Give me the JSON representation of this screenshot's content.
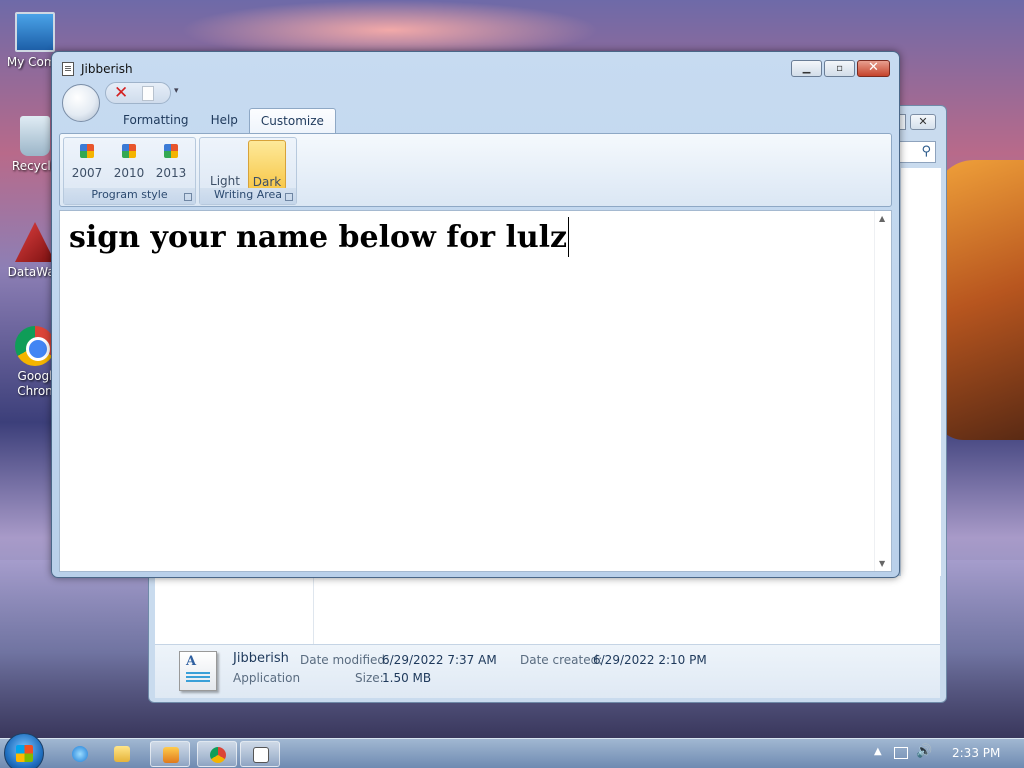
{
  "desktop": {
    "icons": [
      {
        "label": "My Comp"
      },
      {
        "label": "Recycle"
      },
      {
        "label": "DataWag"
      },
      {
        "label": "Googl Chron"
      }
    ]
  },
  "background_window": {
    "close_glyph": "✕",
    "help_glyph": "?",
    "search_glyph": "⚲",
    "details": {
      "name": "Jibberish",
      "type": "Application",
      "date_modified_label": "Date modified:",
      "date_modified": "6/29/2022 7:37 AM",
      "date_created_label": "Date created:",
      "date_created": "6/29/2022 2:10 PM",
      "size_label": "Size:",
      "size": "1.50 MB"
    }
  },
  "window": {
    "title": "Jibberish",
    "minimize_glyph": "▁",
    "maximize_glyph": "▫",
    "close_glyph": "✕",
    "tabs": [
      {
        "label": "Formatting"
      },
      {
        "label": "Help"
      },
      {
        "label": "Customize"
      }
    ],
    "active_tab": "Customize",
    "ribbon": {
      "program_style": {
        "label": "Program style",
        "buttons": [
          {
            "label": "2007"
          },
          {
            "label": "2010"
          },
          {
            "label": "2013"
          }
        ]
      },
      "writing_area": {
        "label": "Writing Area",
        "buttons": [
          {
            "label": "Light"
          },
          {
            "label": "Dark"
          }
        ],
        "selected": "Dark"
      }
    },
    "editor": {
      "text": "sign your name below for lulz"
    }
  },
  "taskbar": {
    "clock": "2:33 PM",
    "tray_arrow": "▲",
    "volume_glyph": "🔊"
  }
}
